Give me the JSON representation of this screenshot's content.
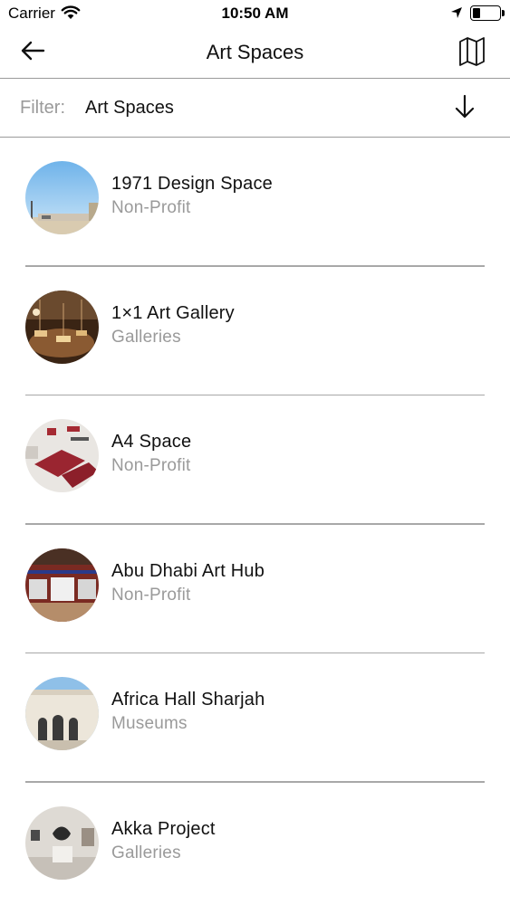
{
  "status_bar": {
    "carrier": "Carrier",
    "time": "10:50 AM",
    "battery_level_percent": 30
  },
  "nav": {
    "title": "Art Spaces",
    "back_icon": "arrow-left-icon",
    "map_icon": "map-icon"
  },
  "filter": {
    "label": "Filter:",
    "value": "Art Spaces",
    "sort_icon": "arrow-down-icon"
  },
  "spaces": [
    {
      "name": "1971 Design Space",
      "category": "Non-Profit"
    },
    {
      "name": "1×1 Art Gallery",
      "category": "Galleries"
    },
    {
      "name": "A4 Space",
      "category": "Non-Profit"
    },
    {
      "name": "Abu Dhabi Art Hub",
      "category": "Non-Profit"
    },
    {
      "name": "Africa Hall Sharjah",
      "category": "Museums"
    },
    {
      "name": "Akka Project",
      "category": "Galleries"
    }
  ],
  "colors": {
    "text_primary": "#111111",
    "text_secondary": "#9a9a9a",
    "divider": "#a8a8a8"
  }
}
